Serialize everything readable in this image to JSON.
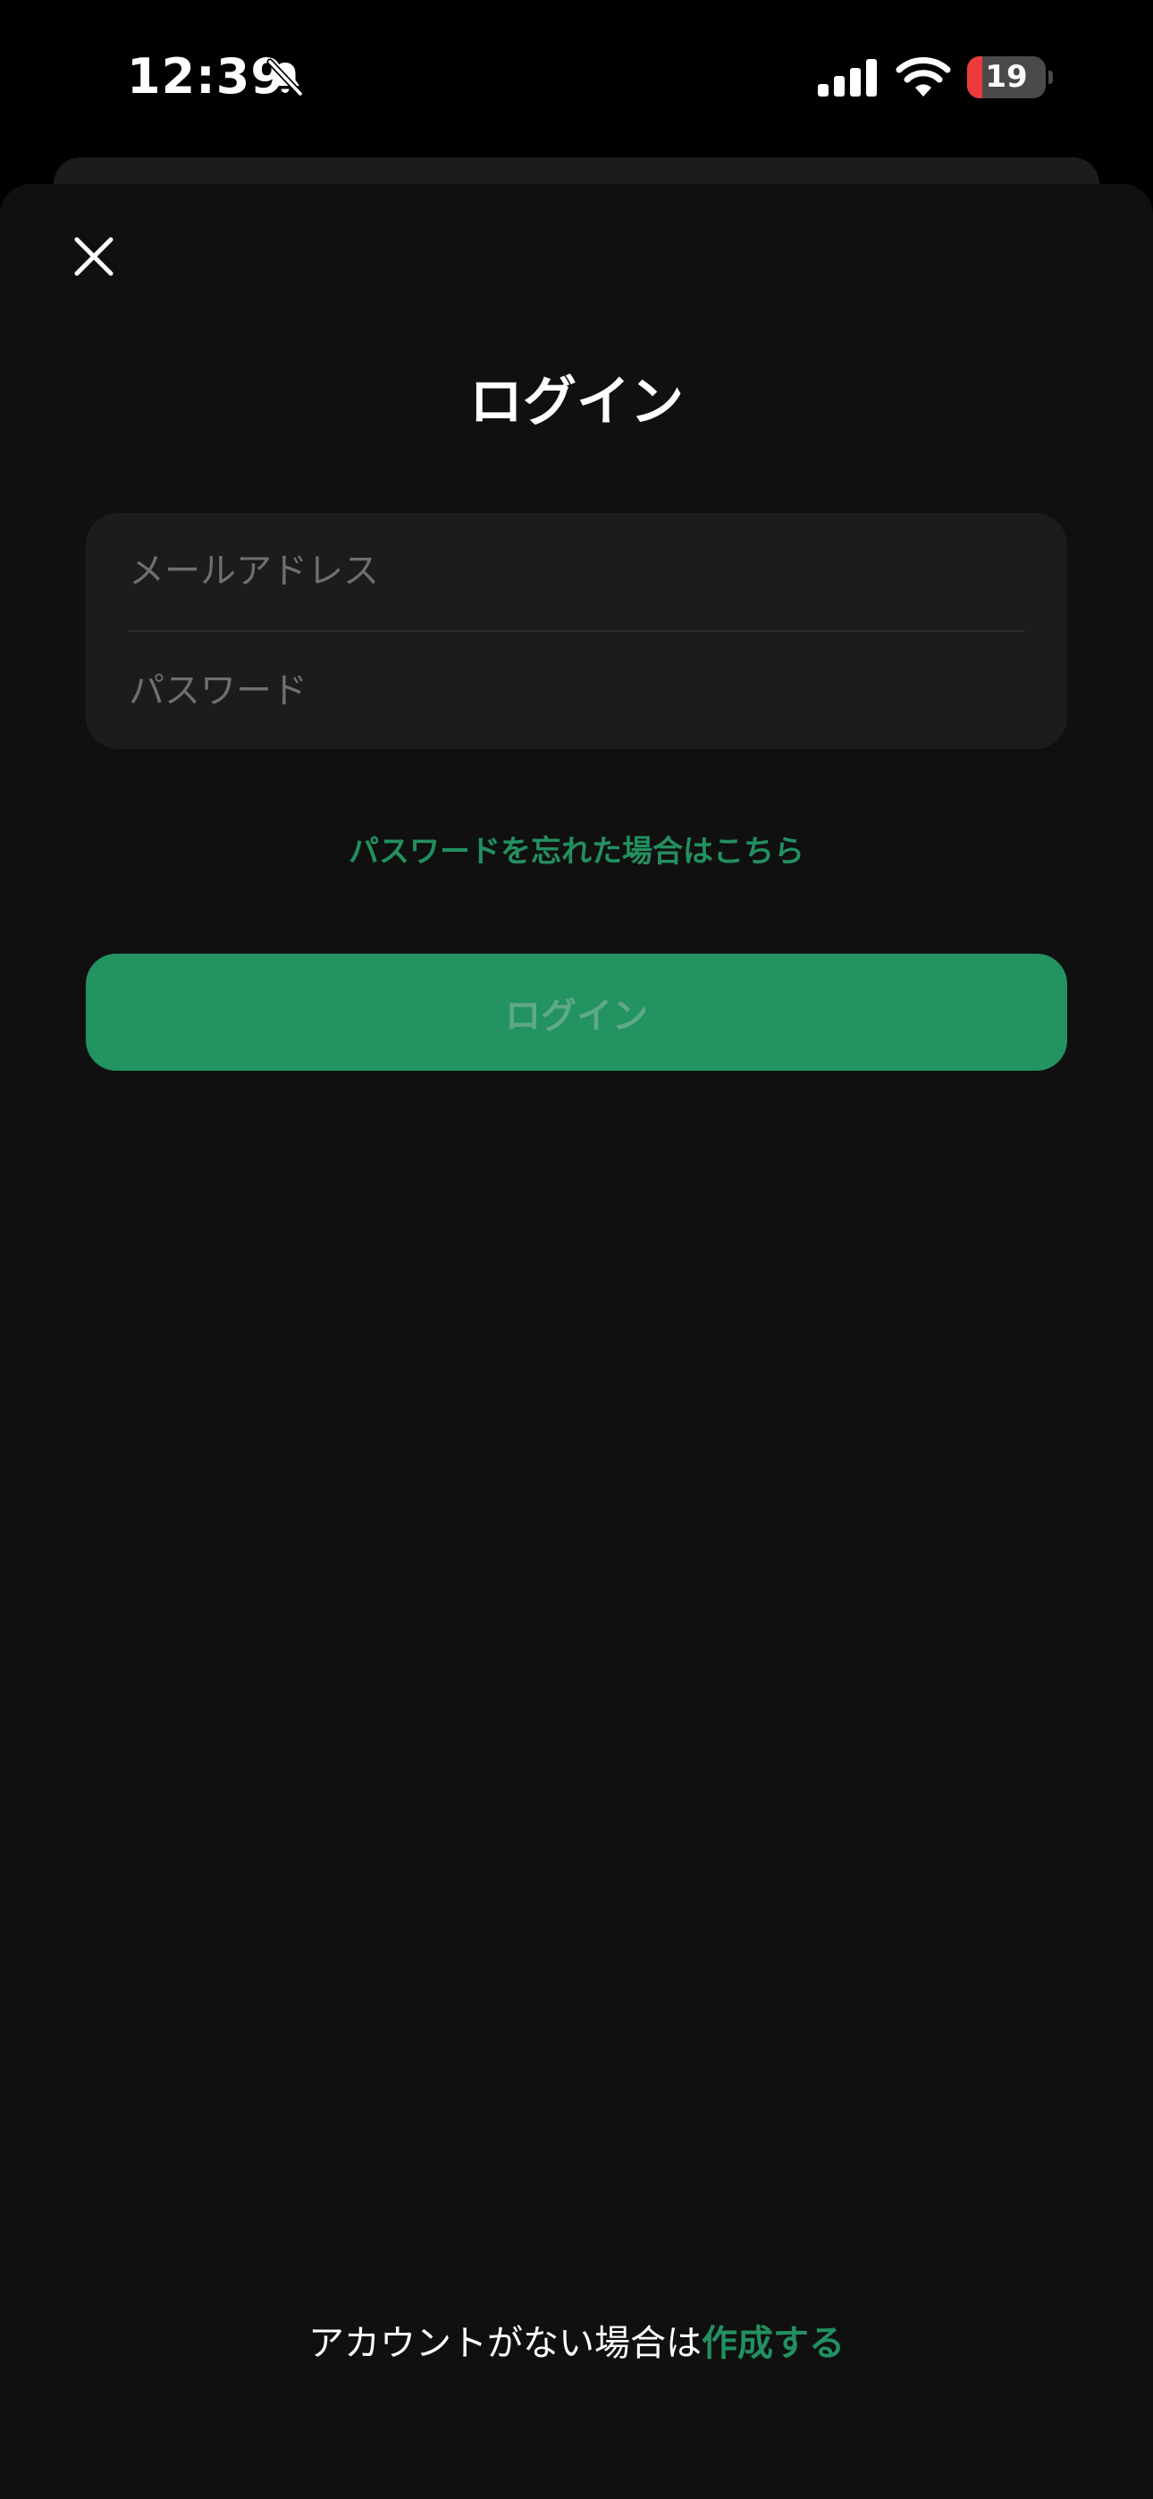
{
  "status_bar": {
    "time": "12:39",
    "silent_icon": "bell-slash-icon",
    "signal_icon": "cellular-signal-icon",
    "wifi_icon": "wifi-icon",
    "battery_level": "19",
    "battery_fraction": 0.19,
    "battery_low_color": "#eb3b3b"
  },
  "sheet": {
    "close_icon": "close-icon",
    "title": "ログイン"
  },
  "form": {
    "email": {
      "value": "",
      "placeholder": "メールアドレス"
    },
    "password": {
      "value": "",
      "placeholder": "パスワード"
    },
    "forgot_password_label": "パスワードを忘れた場合はこちら",
    "login_button_label": "ログイン"
  },
  "footer": {
    "prompt": "アカウントがない場合は",
    "signup_link": "作成する"
  },
  "colors": {
    "accent": "#22905f",
    "button_bg": "#229361",
    "button_text_disabled": "#5fa987",
    "sheet_bg": "#101010",
    "field_bg": "#1c1c1c",
    "placeholder": "#6e6e73"
  }
}
